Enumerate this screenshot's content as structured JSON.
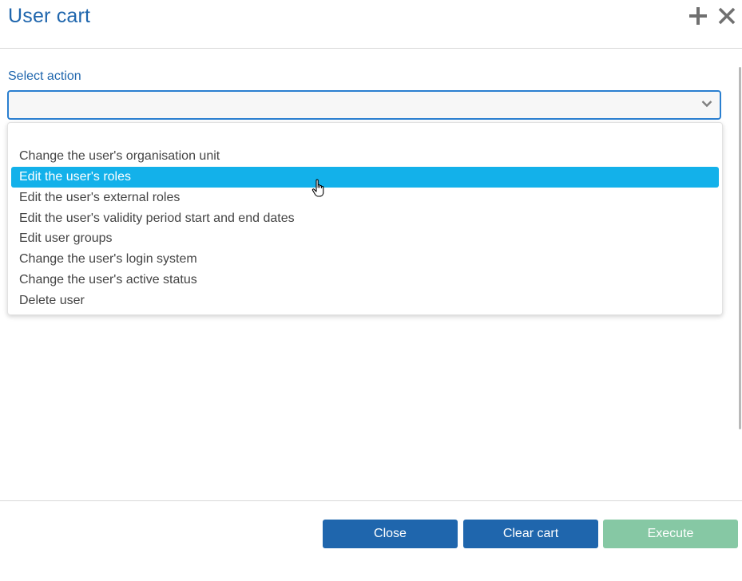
{
  "header": {
    "title": "User cart",
    "add_icon": "plus-icon",
    "close_icon": "close-icon"
  },
  "form": {
    "label": "Select action",
    "selected_value": "",
    "dropdown_icon": "chevron-down-icon",
    "options": [
      "",
      "Change the user's organisation unit",
      "Edit the user's roles",
      "Edit the user's external roles",
      "Edit the user's validity period start and end dates",
      "Edit user groups",
      "Change the user's login system",
      "Change the user's active status",
      "Delete user"
    ],
    "highlighted_option": "Edit the user's roles"
  },
  "footer": {
    "close_label": "Close",
    "clear_label": "Clear cart",
    "execute_label": "Execute",
    "execute_enabled": false
  },
  "colors": {
    "accent": "#1f66ad",
    "highlight": "#13b1ea",
    "execute_disabled": "#86c8a4"
  }
}
